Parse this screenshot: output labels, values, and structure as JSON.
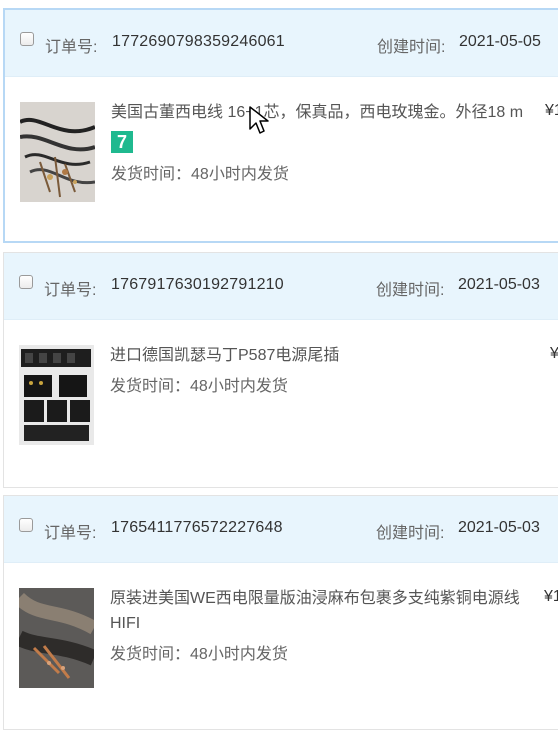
{
  "order_no_label": "订单号:",
  "created_label": "创建时间:",
  "ship_label": "发货时间：",
  "orders": [
    {
      "order_no": "1772690798359246061",
      "created": "2021-05-05",
      "title": "美国古董西电线 1⁠6+1芯，保真品，西电玫瑰金。外径18 m",
      "badge": "7",
      "ship_time": "48小时内发货",
      "price_prefix": "¥1"
    },
    {
      "order_no": "1767917630192791210",
      "created": "2021-05-03",
      "title": "进口德国凯瑟马丁P587电源尾插",
      "ship_time": "48小时内发货",
      "price_prefix": "¥"
    },
    {
      "order_no": "1765411776572227648",
      "created": "2021-05-03",
      "title": "原装进美国WE西电限量版油浸麻布包裹多支纯紫铜电源线HIFI",
      "ship_time": "48小时内发货",
      "price_prefix": "¥1"
    }
  ]
}
